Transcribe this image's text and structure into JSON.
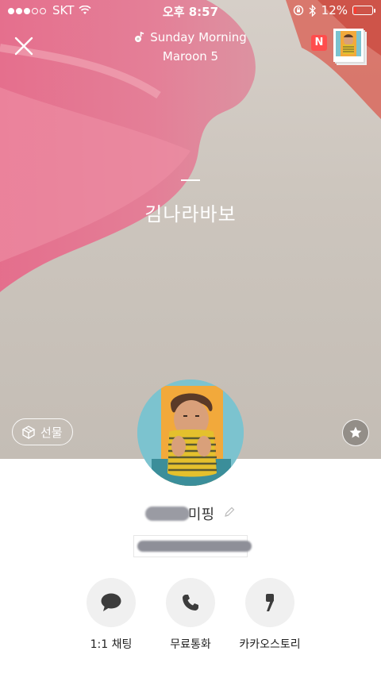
{
  "status_bar": {
    "carrier": "SKT",
    "time": "오후 8:57",
    "battery": "12%",
    "battery_level": 0.12
  },
  "music": {
    "song": "Sunday Morning",
    "artist": "Maroon 5"
  },
  "photos": {
    "badge": "N"
  },
  "profile": {
    "status_message": "김나라바보",
    "name_visible_part": "미핑",
    "gift_label": "선물"
  },
  "actions": [
    {
      "label": "1:1 채팅"
    },
    {
      "label": "무료통화"
    },
    {
      "label": "카카오스토리"
    }
  ],
  "colors": {
    "battery_low": "#ff3b30",
    "badge": "#ff4d4d",
    "action_bg": "#f0f0f0"
  }
}
